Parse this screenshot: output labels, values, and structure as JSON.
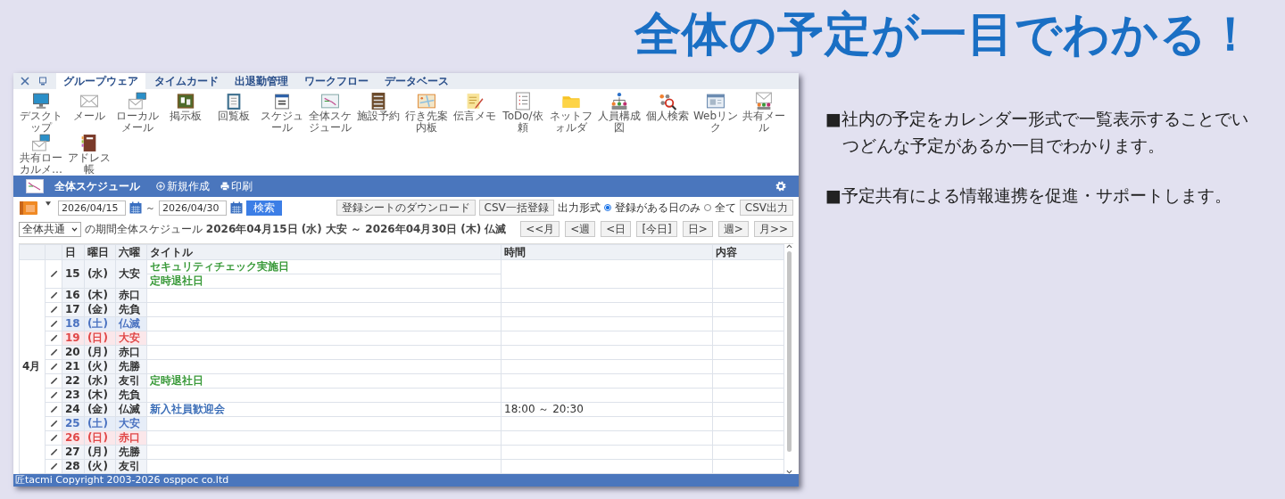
{
  "headline": "全体の予定が一目でわかる！",
  "window": {
    "tabs": [
      {
        "label": "グループウェア",
        "selected": true
      },
      {
        "label": "タイムカード",
        "selected": false
      },
      {
        "label": "出退勤管理",
        "selected": false
      },
      {
        "label": "ワークフロー",
        "selected": false
      },
      {
        "label": "データベース",
        "selected": false
      }
    ],
    "launchers": [
      {
        "label": "デスクトップ"
      },
      {
        "label": "メール"
      },
      {
        "label": "ローカルメール"
      },
      {
        "label": "掲示板"
      },
      {
        "label": "回覧板"
      },
      {
        "label": "スケジュール"
      },
      {
        "label": "全体スケジュール"
      },
      {
        "label": "施設予約"
      },
      {
        "label": "行き先案内板"
      },
      {
        "label": "伝言メモ"
      },
      {
        "label": "ToDo/依頼"
      },
      {
        "label": "ネットフォルダ"
      },
      {
        "label": "人員構成図"
      },
      {
        "label": "個人検索"
      },
      {
        "label": "Webリンク"
      },
      {
        "label": "共有メール"
      },
      {
        "label": "共有ローカルメ…"
      },
      {
        "label": "アドレス帳"
      }
    ],
    "header": {
      "title": "全体スケジュール",
      "new_label": "新規作成",
      "print_label": "印刷"
    },
    "toolbar": {
      "date_from": "2026/04/15",
      "range_separator": "～",
      "date_to": "2026/04/30",
      "search_button": "検索",
      "download_button": "登録シートのダウンロード",
      "import_button": "CSV一括登録",
      "output_label": "出力形式",
      "output_options": [
        {
          "label": "登録がある日のみ",
          "selected": true
        },
        {
          "label": "全て",
          "selected": false
        }
      ],
      "export_button": "CSV出力"
    },
    "filter": {
      "group": "全体共通",
      "period_text": "の期間全体スケジュール **2026年04月15日 (水) 大安 ～ 2026年04月30日 (木) 仏滅**"
    },
    "nav_buttons": [
      "<<月",
      "<週",
      "<日",
      "[今日]",
      "日>",
      "週>",
      "月>>"
    ],
    "table": {
      "columns": [
        "日",
        "曜日",
        "六曜",
        "タイトル",
        "時間",
        "内容"
      ],
      "month": "4月",
      "rows": [
        {
          "day": "15",
          "weekday": "(水)",
          "rokuyo": "大安",
          "kind": "weekday",
          "events": [
            {
              "title": "セキュリティチェック実施日",
              "color": "#3a9a3a"
            },
            {
              "title": "定時退社日",
              "color": "#3a9a3a"
            }
          ]
        },
        {
          "day": "16",
          "weekday": "(木)",
          "rokuyo": "赤口",
          "kind": "weekday"
        },
        {
          "day": "17",
          "weekday": "(金)",
          "rokuyo": "先負",
          "kind": "weekday"
        },
        {
          "day": "18",
          "weekday": "(土)",
          "rokuyo": "仏滅",
          "kind": "saturday"
        },
        {
          "day": "19",
          "weekday": "(日)",
          "rokuyo": "大安",
          "kind": "sunday"
        },
        {
          "day": "20",
          "weekday": "(月)",
          "rokuyo": "赤口",
          "kind": "weekday"
        },
        {
          "day": "21",
          "weekday": "(火)",
          "rokuyo": "先勝",
          "kind": "weekday"
        },
        {
          "day": "22",
          "weekday": "(水)",
          "rokuyo": "友引",
          "kind": "weekday",
          "events": [
            {
              "title": "定時退社日",
              "color": "#3a9a3a"
            }
          ]
        },
        {
          "day": "23",
          "weekday": "(木)",
          "rokuyo": "先負",
          "kind": "weekday"
        },
        {
          "day": "24",
          "weekday": "(金)",
          "rokuyo": "仏滅",
          "kind": "weekday",
          "events": [
            {
              "title": "新入社員歓迎会",
              "color": "#3d6fb8"
            }
          ],
          "time": "18:00 ～ 20:30"
        },
        {
          "day": "25",
          "weekday": "(土)",
          "rokuyo": "大安",
          "kind": "saturday"
        },
        {
          "day": "26",
          "weekday": "(日)",
          "rokuyo": "赤口",
          "kind": "sunday"
        },
        {
          "day": "27",
          "weekday": "(月)",
          "rokuyo": "先勝",
          "kind": "weekday"
        },
        {
          "day": "28",
          "weekday": "(火)",
          "rokuyo": "友引",
          "kind": "weekday"
        }
      ]
    },
    "footer": "匠tacmi Copyright 2003-2026 osppoc co.ltd"
  },
  "bullets": [
    "■社内の予定をカレンダー形式で一覧表示することでいつどんな予定があるか一目でわかります。",
    "■予定共有による情報連携を促進・サポートします。"
  ]
}
